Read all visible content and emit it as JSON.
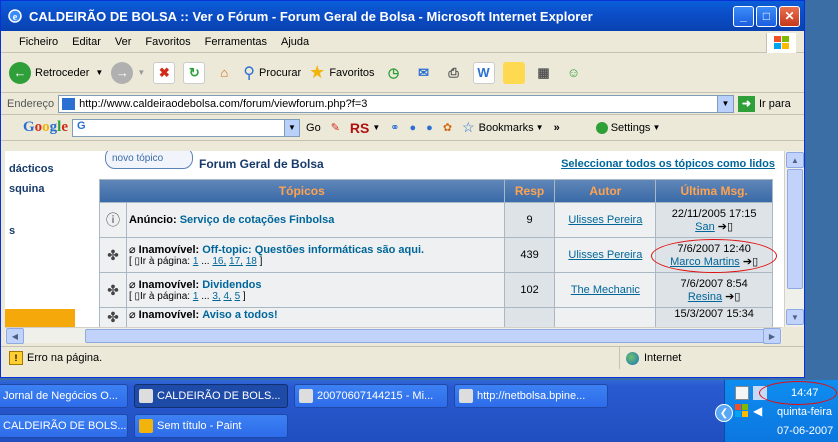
{
  "window": {
    "title": "CALDEIRÃO DE BOLSA :: Ver o Fórum - Forum Geral de Bolsa - Microsoft Internet Explorer",
    "min_label": "_",
    "max_label": "□",
    "close_label": "✕"
  },
  "menu": [
    "Ficheiro",
    "Editar",
    "Ver",
    "Favoritos",
    "Ferramentas",
    "Ajuda"
  ],
  "toolbar": {
    "back_label": "Retroceder",
    "search_label": "Procurar",
    "favorites_label": "Favoritos"
  },
  "address": {
    "label": "Endereço",
    "url": "http://www.caldeiraodebolsa.com/forum/viewforum.php?f=3",
    "go_label": "Ir para"
  },
  "google": {
    "logo": "Google",
    "search_prefix": "G",
    "go_label": "Go",
    "rs_label": "RS",
    "bookmarks_label": "Bookmarks",
    "more_label": "»",
    "settings_label": "Settings"
  },
  "leftnav": [
    "dácticos",
    "squina",
    "s"
  ],
  "forum": {
    "new_topic_label": "novo tópico",
    "forum_name": "Forum Geral de Bolsa",
    "select_all_label": "Seleccionar todos os tópicos como lidos",
    "columns": [
      "Tópicos",
      "Resp",
      "Autor",
      "Última Msg."
    ],
    "rows": [
      {
        "prefix": "Anúncio:",
        "title": "Serviço de cotações Finbolsa",
        "pages_label": "",
        "pages": [],
        "replies": "9",
        "author": "Ulisses Pereira",
        "last_date": "22/11/2005 17:15",
        "last_user": "San"
      },
      {
        "prefix": "Inamovível:",
        "title": "Off-topic: Questões informáticas são aqui.",
        "pages_label": "Ir à página:",
        "pages": [
          "1",
          "...",
          "16,",
          "17,",
          "18"
        ],
        "replies": "439",
        "author": "Ulisses Pereira",
        "last_date": "7/6/2007 12:40",
        "last_user": "Marco Martins"
      },
      {
        "prefix": "Inamovível:",
        "title": "Dividendos",
        "pages_label": "Ir à página:",
        "pages": [
          "1",
          "...",
          "3,",
          "4,",
          "5"
        ],
        "replies": "102",
        "author": "The Mechanic",
        "last_date": "7/6/2007 8:54",
        "last_user": "Resina"
      },
      {
        "prefix": "Inamovível:",
        "title": "Aviso a todos!",
        "pages_label": "",
        "pages": [],
        "replies": "",
        "author": "",
        "last_date": "15/3/2007 15:34",
        "last_user": ""
      }
    ]
  },
  "status": {
    "message": "Erro na página.",
    "zone": "Internet"
  },
  "taskbar": {
    "tasks_row1": [
      "Jornal de Negócios O...",
      "CALDEIRÃO DE BOLS...",
      "20070607144215 - Mi...",
      "http://netbolsa.bpine..."
    ],
    "tasks_row2": [
      "CALDEIRÃO DE BOLS...",
      "Sem título - Paint"
    ],
    "clock_time": "14:47",
    "clock_day": "quinta-feira",
    "clock_date": "07-06-2007"
  }
}
